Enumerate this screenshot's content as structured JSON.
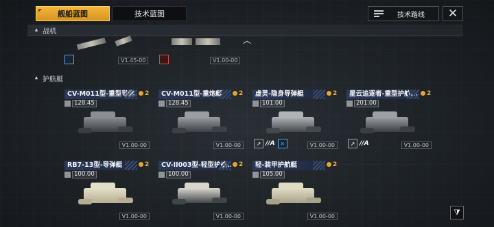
{
  "tabs": [
    {
      "label": "舰船蓝图",
      "active": true
    },
    {
      "label": "技术蓝图",
      "active": false
    }
  ],
  "tech_route_button": {
    "label": "技术路线",
    "icon": "list-icon"
  },
  "close_button": {
    "label": "✕",
    "icon": "close-icon"
  },
  "sections": {
    "fighter": {
      "label": "战机",
      "collapse_glyph": "︿"
    },
    "escort": {
      "label": "护航艇"
    }
  },
  "fighter_costs": [
    "V1.45-00",
    "V1.00-00"
  ],
  "cards": [
    {
      "title": "CV-M011型-重型导弹...",
      "rank": "2",
      "stat": "128.45",
      "cost": "V1.00-00",
      "mods": []
    },
    {
      "title": "CV-M011型-重炮艇",
      "rank": "2",
      "stat": "128.45",
      "cost": "V1.00-00",
      "mods": []
    },
    {
      "title": "虚灵-隐身导弹艇",
      "rank": "2",
      "stat": "101.00",
      "cost": "V1.00-00",
      "mods": [
        {
          "label": "//A"
        },
        {
          "label": ""
        }
      ]
    },
    {
      "title": "星云追逐者-重型护航...",
      "rank": "2",
      "stat": "201.00",
      "cost": "V1.00-00",
      "mods": [
        {
          "label": "//A"
        }
      ]
    },
    {
      "title": "RB7-13型-导弹艇",
      "rank": "2",
      "stat": "100.00",
      "cost": "V1.00-00",
      "mods": []
    },
    {
      "title": "CV-II003型-轻型护航...",
      "rank": "2",
      "stat": "100.00",
      "cost": "V1.00-00",
      "mods": []
    },
    {
      "title": "轻-装甲护航艇",
      "rank": "2",
      "stat": "105.00",
      "cost": "V1.00-00",
      "mods": []
    }
  ],
  "filter_button": {
    "icon": "filter-icon"
  },
  "colors": {
    "accent": "#f0b43c",
    "title_bar": "#2c3a5a",
    "mod_blue": "#5aa6e6"
  }
}
